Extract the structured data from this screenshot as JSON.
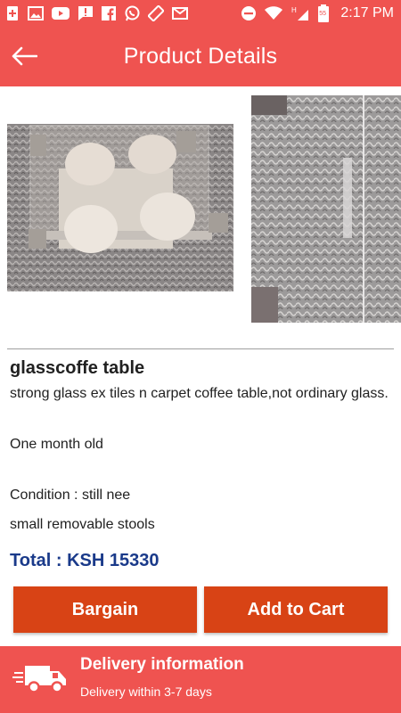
{
  "status_bar": {
    "time": "2:17 PM",
    "signal_label": "H",
    "battery_level": "55",
    "icons": [
      "add-icon",
      "image-icon",
      "youtube-icon",
      "alert-icon",
      "facebook-icon",
      "whatsapp-icon",
      "rotate-icon",
      "mail-icon",
      "minus-icon",
      "wifi-icon",
      "signal-icon",
      "battery-icon"
    ]
  },
  "app_bar": {
    "title": "Product Details",
    "back_icon": "arrow-left-icon"
  },
  "product": {
    "name": "glasscoffe table",
    "description": "strong glass ex tiles n carpet coffee table,not ordinary glass.",
    "age": "One month old",
    "condition": "Condition : still nee",
    "extra": "small removable stools",
    "total": "Total : KSH 15330"
  },
  "actions": {
    "bargain_label": "Bargain",
    "add_to_cart_label": "Add to Cart"
  },
  "delivery": {
    "title": "Delivery information",
    "subtitle": "Delivery within 3-7 days",
    "icon": "truck-icon"
  },
  "colors": {
    "primary": "#ef5350",
    "button": "#d84315",
    "total_text": "#1a3a8a"
  }
}
